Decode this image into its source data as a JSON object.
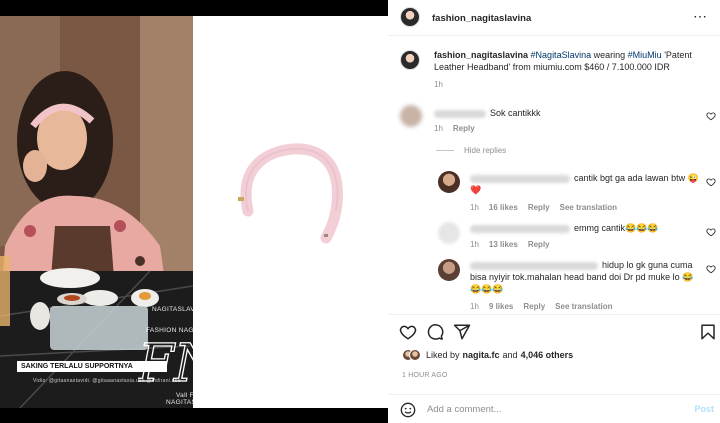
{
  "media": {
    "watermark_lines": [
      "NAGITASLAVINA",
      "FASHION NAGITA SLAVINA",
      "Vall FAMILY",
      "NAGITASLAVINA"
    ],
    "logo_letters": "FNS",
    "caption_bar_text": "SAKING TERLALU SUPPORTNYA",
    "caption_under": "Vidio: @gitaanastavidi. @gitaaanastasia.usk @indirani.sbe"
  },
  "header": {
    "username": "fashion_nagitaslavina"
  },
  "post": {
    "username": "fashion_nagitaslavina",
    "hashtag1": "#NagitaSlavina",
    "word_wearing": "wearing",
    "hashtag2": "#MiuMiu",
    "caption_rest": "'Patent Leather Headband' from miumiu.com $460 / 7.100.000 IDR",
    "time": "1h"
  },
  "comments": [
    {
      "text": "Sok cantikkk",
      "time": "1h",
      "reply_label": "Reply"
    }
  ],
  "hide_replies_label": "Hide replies",
  "replies": [
    {
      "text": "cantik bgt ga ada lawan btw 😜❤️",
      "time": "1h",
      "likes": "16 likes",
      "reply_label": "Reply",
      "translation": "See translation"
    },
    {
      "text": "emmg cantik😂😂😂",
      "time": "1h",
      "likes": "13 likes",
      "reply_label": "Reply"
    },
    {
      "text": "hidup lo gk guna cuma bisa nyiyir tok.mahalan head band doi Dr pd muke lo 😂😂😂😂",
      "time": "1h",
      "likes": "9 likes",
      "reply_label": "Reply",
      "translation": "See translation"
    }
  ],
  "likes": {
    "prefix": "Liked by",
    "user": "nagita.fc",
    "and": "and",
    "others": "4,046 others"
  },
  "post_time": "1 HOUR AGO",
  "add_comment": {
    "placeholder": "Add a comment...",
    "post_label": "Post"
  },
  "colors": {
    "link": "#00376b",
    "muted": "#8e8e8e",
    "post_button": "#b2dffc",
    "headband": "#f2cfd6",
    "heart": "#ed4956"
  }
}
